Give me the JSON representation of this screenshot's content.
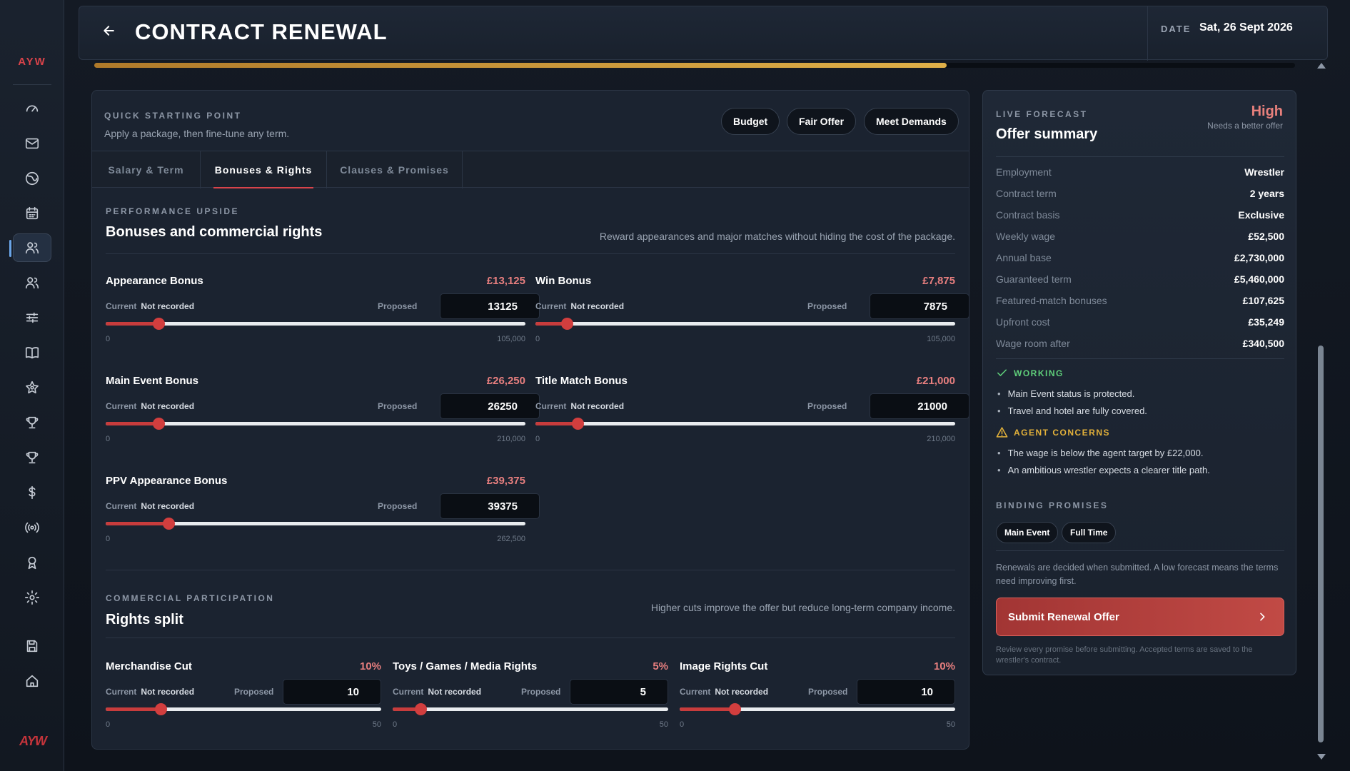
{
  "sidebar": {
    "brand": "AYW",
    "logo_text": "AYW",
    "icons": [
      "gauge-icon",
      "mail-icon",
      "globe-icon",
      "calendar-icon",
      "roster-icon",
      "people-icon",
      "sliders-icon",
      "book-icon",
      "star-icon",
      "trophy-icon",
      "trophy-alt-icon",
      "dollar-icon",
      "broadcast-icon",
      "award-icon",
      "gear-icon",
      "save-icon",
      "home-icon"
    ],
    "active_index": 4
  },
  "header": {
    "title": "CONTRACT RENEWAL",
    "date_label": "DATE",
    "date_value": "Sat, 26 Sept 2026",
    "progress_percent": 71
  },
  "quick_start": {
    "label": "QUICK STARTING POINT",
    "subtitle": "Apply a package, then fine-tune any term.",
    "buttons": [
      "Budget",
      "Fair Offer",
      "Meet Demands"
    ]
  },
  "tabs": [
    {
      "label": "Salary & Term",
      "active": false
    },
    {
      "label": "Bonuses & Rights",
      "active": true
    },
    {
      "label": "Clauses & Promises",
      "active": false
    }
  ],
  "performance": {
    "label": "PERFORMANCE UPSIDE",
    "title": "Bonuses and commercial rights",
    "description": "Reward appearances and major matches without hiding the cost of the package.",
    "bonuses": [
      {
        "name": "Appearance Bonus",
        "amount": "£13,125",
        "current_label": "Current",
        "current": "Not recorded",
        "proposed_label": "Proposed",
        "proposed": "13125",
        "min": "0",
        "max": "105,000",
        "fraction": 0.125
      },
      {
        "name": "Win Bonus",
        "amount": "£7,875",
        "current_label": "Current",
        "current": "Not recorded",
        "proposed_label": "Proposed",
        "proposed": "7875",
        "min": "0",
        "max": "105,000",
        "fraction": 0.075
      },
      {
        "name": "Main Event Bonus",
        "amount": "£26,250",
        "current_label": "Current",
        "current": "Not recorded",
        "proposed_label": "Proposed",
        "proposed": "26250",
        "min": "0",
        "max": "210,000",
        "fraction": 0.125
      },
      {
        "name": "Title Match Bonus",
        "amount": "£21,000",
        "current_label": "Current",
        "current": "Not recorded",
        "proposed_label": "Proposed",
        "proposed": "21000",
        "min": "0",
        "max": "210,000",
        "fraction": 0.1
      },
      {
        "name": "PPV Appearance Bonus",
        "amount": "£39,375",
        "current_label": "Current",
        "current": "Not recorded",
        "proposed_label": "Proposed",
        "proposed": "39375",
        "min": "0",
        "max": "262,500",
        "fraction": 0.15
      }
    ]
  },
  "commercial": {
    "label": "COMMERCIAL PARTICIPATION",
    "title": "Rights split",
    "description": "Higher cuts improve the offer but reduce long-term company income.",
    "rights": [
      {
        "name": "Merchandise Cut",
        "amount": "10%",
        "current_label": "Current",
        "current": "Not recorded",
        "proposed_label": "Proposed",
        "proposed": "10",
        "min": "0",
        "max": "50",
        "fraction": 0.2
      },
      {
        "name": "Toys / Games / Media Rights",
        "amount": "5%",
        "current_label": "Current",
        "current": "Not recorded",
        "proposed_label": "Proposed",
        "proposed": "5",
        "min": "0",
        "max": "50",
        "fraction": 0.1
      },
      {
        "name": "Image Rights Cut",
        "amount": "10%",
        "current_label": "Current",
        "current": "Not recorded",
        "proposed_label": "Proposed",
        "proposed": "10",
        "min": "0",
        "max": "50",
        "fraction": 0.2
      }
    ]
  },
  "summary": {
    "label": "LIVE FORECAST",
    "title": "Offer summary",
    "level": "High",
    "level_note": "Needs a better offer",
    "rows": [
      {
        "k": "Employment",
        "v": "Wrestler"
      },
      {
        "k": "Contract term",
        "v": "2 years"
      },
      {
        "k": "Contract basis",
        "v": "Exclusive"
      },
      {
        "k": "Weekly wage",
        "v": "£52,500"
      },
      {
        "k": "Annual base",
        "v": "£2,730,000"
      },
      {
        "k": "Guaranteed term",
        "v": "£5,460,000"
      },
      {
        "k": "Featured-match bonuses",
        "v": "£107,625"
      },
      {
        "k": "Upfront cost",
        "v": "£35,249"
      },
      {
        "k": "Wage room after",
        "v": "£340,500"
      }
    ],
    "working_label": "WORKING",
    "working": [
      "Main Event status is protected.",
      "Travel and hotel are fully covered."
    ],
    "concerns_label": "AGENT CONCERNS",
    "concerns": [
      "The wage is below the agent target by £22,000.",
      "An ambitious wrestler expects a clearer title path."
    ],
    "promises_label": "BINDING PROMISES",
    "promises": [
      "Main Event",
      "Full Time"
    ],
    "note": "Renewals are decided when submitted. A low forecast means the terms need improving first.",
    "submit_label": "Submit Renewal Offer",
    "fine_print": "Review every promise before submitting. Accepted terms are saved to the wrestler's contract."
  },
  "colors": {
    "accent_red": "#d23e3e",
    "forecast_high": "#e8807c",
    "working_green": "#5fcf7a",
    "concern_amber": "#e3b13a",
    "progress_gold": "#e0b048"
  }
}
